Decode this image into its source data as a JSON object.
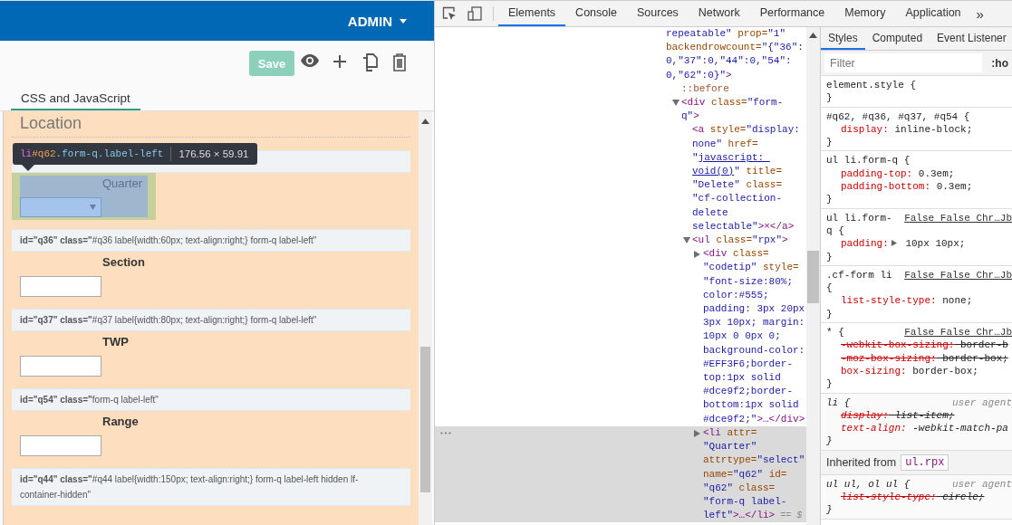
{
  "app": {
    "user_menu": "ADMIN",
    "save_button": "Save",
    "tabs": [
      {
        "label": "CSS and JavaScript",
        "selected": true
      }
    ],
    "section_title": "Location",
    "items": [
      {
        "kind": "codetip"
      },
      {
        "kind": "question",
        "label": "Quarter",
        "field": {
          "kind": "select"
        },
        "highlighted": true
      },
      {
        "kind": "codetip",
        "text": "**id=\"q36\" class=\"**#q36 label{width:60px; text-align:right;} form-q label-left\""
      },
      {
        "kind": "question",
        "label": "Section",
        "field": {
          "kind": "text"
        },
        "highlighted": false
      },
      {
        "kind": "codetip",
        "text": "**id=\"q37\" class=\"**#q37 label{width:80px; text-align:right;} form-q label-left\""
      },
      {
        "kind": "question",
        "label": "TWP",
        "field": {
          "kind": "text"
        },
        "highlighted": false
      },
      {
        "kind": "codetip",
        "text": "**id=\"q54\" class=\"**form-q label-left\""
      },
      {
        "kind": "question",
        "label": "Range",
        "field": {
          "kind": "text"
        },
        "highlighted": false
      },
      {
        "kind": "codetip",
        "text": "**id=\"q44\" class=\"**#q44 label{width:150px; text-align:right;} form-q label-left hidden lf-container-hidden\""
      }
    ],
    "tooltip": {
      "tag": "li",
      "id": "#q62",
      "classes": ".form-q.label-left",
      "size": "176.56 × 59.91"
    }
  },
  "devtools": {
    "tabs": [
      {
        "label": "Elements",
        "selected": true
      },
      {
        "label": "Console",
        "selected": false
      },
      {
        "label": "Sources",
        "selected": false
      },
      {
        "label": "Network",
        "selected": false
      },
      {
        "label": "Performance",
        "selected": false
      },
      {
        "label": "Memory",
        "selected": false
      },
      {
        "label": "Application",
        "selected": false
      }
    ],
    "more_tabs": "»",
    "tree": {
      "lines": [
        [
          {
            "kind": "val",
            "text": "repeatable\""
          },
          {
            "kind": "attr",
            "text": " prop="
          },
          {
            "kind": "val",
            "text": "\"1\""
          }
        ],
        [
          {
            "kind": "attr",
            "text": "backendrowcount="
          },
          {
            "kind": "val",
            "text": "\"{\"36\":"
          }
        ],
        [
          {
            "kind": "val",
            "text": "0,\"37\":0,\"44\":0,\"54\":"
          }
        ],
        [
          {
            "kind": "val",
            "text": "0,\"62\":0}\""
          },
          {
            "kind": "tag",
            "text": ">"
          }
        ]
      ],
      "children": [
        {
          "selected": false,
          "lines": [
            [
              {
                "kind": "pseudo",
                "text": "::before"
              }
            ]
          ]
        },
        {
          "selected": false,
          "expanded": true,
          "lines": [
            [
              {
                "kind": "tag",
                "text": "<div"
              },
              {
                "kind": "attr",
                "text": " class="
              },
              {
                "kind": "val",
                "text": "\"form-"
              }
            ],
            [
              {
                "kind": "val",
                "text": "q\""
              },
              {
                "kind": "tag",
                "text": ">"
              }
            ]
          ],
          "children": [
            {
              "selected": false,
              "lines": [
                [
                  {
                    "kind": "tag",
                    "text": "<a"
                  },
                  {
                    "kind": "attr",
                    "text": " style="
                  },
                  {
                    "kind": "val",
                    "text": "\"display:"
                  }
                ],
                [
                  {
                    "kind": "val",
                    "text": "none\""
                  },
                  {
                    "kind": "attr",
                    "text": " href="
                  }
                ],
                [
                  {
                    "kind": "val",
                    "text": "\""
                  },
                  {
                    "kind": "link",
                    "text": "javascript: "
                  }
                ],
                [
                  {
                    "kind": "link",
                    "text": "void(0)"
                  },
                  {
                    "kind": "val",
                    "text": "\""
                  },
                  {
                    "kind": "attr",
                    "text": " title="
                  }
                ],
                [
                  {
                    "kind": "val",
                    "text": "\"Delete\""
                  },
                  {
                    "kind": "attr",
                    "text": " class="
                  }
                ],
                [
                  {
                    "kind": "val",
                    "text": "\"cf-collection-"
                  }
                ],
                [
                  {
                    "kind": "val",
                    "text": "delete"
                  }
                ],
                [
                  {
                    "kind": "val",
                    "text": "selectable\""
                  },
                  {
                    "kind": "tag",
                    "text": ">×</a>"
                  }
                ]
              ]
            },
            {
              "selected": false,
              "expanded": true,
              "lines": [
                [
                  {
                    "kind": "tag",
                    "text": "<ul"
                  },
                  {
                    "kind": "attr",
                    "text": " class="
                  },
                  {
                    "kind": "val",
                    "text": "\"rpx\""
                  },
                  {
                    "kind": "tag",
                    "text": ">"
                  }
                ]
              ],
              "children": [
                {
                  "selected": false,
                  "expanded": false,
                  "lines": [
                    [
                      {
                        "kind": "tag",
                        "text": "<div"
                      },
                      {
                        "kind": "attr",
                        "text": " class="
                      }
                    ],
                    [
                      {
                        "kind": "val",
                        "text": "\"codetip\""
                      },
                      {
                        "kind": "attr",
                        "text": " style="
                      }
                    ],
                    [
                      {
                        "kind": "val",
                        "text": "\"font-size:80%;"
                      }
                    ],
                    [
                      {
                        "kind": "val",
                        "text": "color:#555;"
                      }
                    ],
                    [
                      {
                        "kind": "val",
                        "text": "padding: 3px 20px"
                      }
                    ],
                    [
                      {
                        "kind": "val",
                        "text": "3px 10px; margin:"
                      }
                    ],
                    [
                      {
                        "kind": "val",
                        "text": "10px 0 0px 0;"
                      }
                    ],
                    [
                      {
                        "kind": "val",
                        "text": "background-color:"
                      }
                    ],
                    [
                      {
                        "kind": "val",
                        "text": "#EFF3F6;border-"
                      }
                    ],
                    [
                      {
                        "kind": "val",
                        "text": "top:1px solid"
                      }
                    ],
                    [
                      {
                        "kind": "val",
                        "text": "#dce9f2;border-"
                      }
                    ],
                    [
                      {
                        "kind": "val",
                        "text": "bottom:1px solid"
                      }
                    ],
                    [
                      {
                        "kind": "val",
                        "text": "#dce9f2;\""
                      },
                      {
                        "kind": "tag",
                        "text": ">…</div>"
                      }
                    ]
                  ]
                },
                {
                  "selected": true,
                  "expanded": false,
                  "lines": [
                    [
                      {
                        "kind": "tag",
                        "text": "<li"
                      },
                      {
                        "kind": "attr",
                        "text": " attr="
                      }
                    ],
                    [
                      {
                        "kind": "val",
                        "text": "\"Quarter\""
                      }
                    ],
                    [
                      {
                        "kind": "attr",
                        "text": "attrtype="
                      },
                      {
                        "kind": "val",
                        "text": "\"select\""
                      }
                    ],
                    [
                      {
                        "kind": "attr",
                        "text": "name="
                      },
                      {
                        "kind": "val",
                        "text": "\"q62\""
                      },
                      {
                        "kind": "attr",
                        "text": " id="
                      }
                    ],
                    [
                      {
                        "kind": "val",
                        "text": "\"q62\""
                      },
                      {
                        "kind": "attr",
                        "text": " class="
                      }
                    ],
                    [
                      {
                        "kind": "val",
                        "text": "\"form-q label-"
                      }
                    ],
                    [
                      {
                        "kind": "val",
                        "text": "left\""
                      },
                      {
                        "kind": "tag",
                        "text": ">…</li>"
                      },
                      {
                        "kind": "ref",
                        "text": " == $"
                      }
                    ]
                  ]
                }
              ]
            }
          ]
        }
      ]
    },
    "styles": {
      "tabs": [
        {
          "label": "Styles",
          "selected": true
        },
        {
          "label": "Computed",
          "selected": false
        },
        {
          "label": "Event Listener",
          "selected": false
        }
      ],
      "filter": {
        "placeholder": "Filter"
      },
      "state_toggle": ":ho",
      "rules": [
        {
          "kind": "rule",
          "selector": "element.style {",
          "close": "}"
        },
        {
          "kind": "rule",
          "selector": "#q62, #q36, #q37, #q54 {",
          "close": "}",
          "decls": [
            {
              "prop": "display:",
              "value": " inline-block;",
              "struck": false
            }
          ]
        },
        {
          "kind": "rule",
          "selector": "ul li.form-q {",
          "close": "}",
          "decls": [
            {
              "prop": "padding-top:",
              "value": " 0.3em;",
              "struck": false
            },
            {
              "prop": "padding-bottom:",
              "value": " 0.3em;",
              "struck": false
            }
          ]
        },
        {
          "kind": "rule",
          "selector": "ul li.form-q {",
          "source": {
            "kind": "link",
            "text": "False False Chr…Jb"
          },
          "close": "}",
          "decls": [
            {
              "prop": "padding:",
              "value": " 10px 10px;",
              "struck": false,
              "expandable": true
            }
          ]
        },
        {
          "kind": "rule",
          "selector": ".cf-form li {",
          "source": {
            "kind": "link",
            "text": "False False Chr…Jb"
          },
          "close": "}",
          "decls": [
            {
              "prop": "list-style-type:",
              "value": " none;",
              "struck": false
            }
          ]
        },
        {
          "kind": "rule",
          "selector": "* {",
          "source": {
            "kind": "link",
            "text": "False False Chr…Jb"
          },
          "close": "}",
          "decls": [
            {
              "prop": "-webkit-box-sizing:",
              "value": " border-b",
              "struck": true
            },
            {
              "prop": "-moz-box-sizing:",
              "value": " border-box;",
              "struck": true
            },
            {
              "prop": "box-sizing:",
              "value": " border-box;",
              "struck": false
            }
          ]
        },
        {
          "kind": "rule",
          "selector": "li {",
          "source": {
            "kind": "ua",
            "text": "user agent"
          },
          "close": "}",
          "decls": [
            {
              "prop": "display:",
              "value": " list-item;",
              "struck": true
            },
            {
              "prop": "text-align:",
              "value": " -webkit-match-pa",
              "struck": false
            }
          ]
        },
        {
          "kind": "inherited",
          "label": "Inherited from",
          "selector": "ul.rpx"
        },
        {
          "kind": "rule",
          "selector": "ul ul, ol ul {",
          "source": {
            "kind": "ua",
            "text": "user agent"
          },
          "close": "}",
          "decls": [
            {
              "prop": "list-style-type:",
              "value": " circle;",
              "struck": true
            }
          ]
        }
      ]
    }
  }
}
